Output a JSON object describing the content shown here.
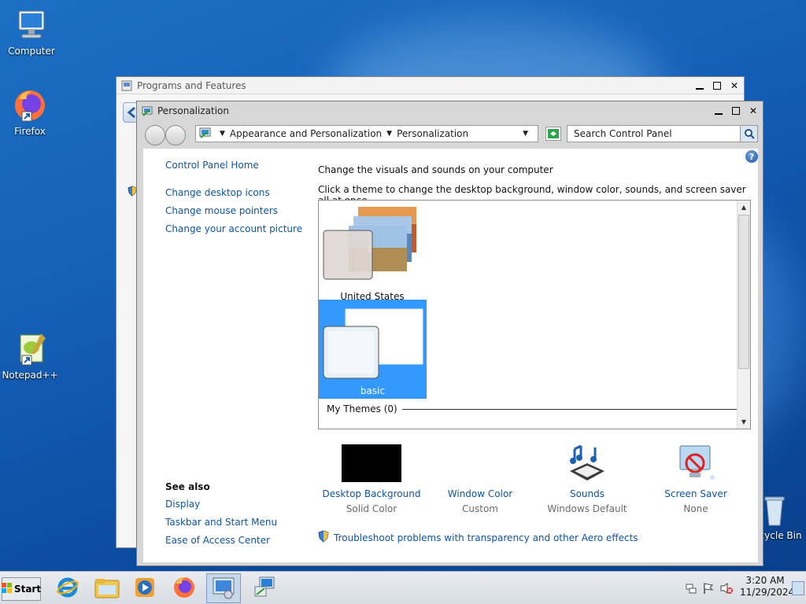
{
  "desktop": {
    "icons": [
      {
        "label": "Computer"
      },
      {
        "label": "Firefox"
      },
      {
        "label": "Notepad++"
      },
      {
        "label": "Recycle Bin"
      }
    ]
  },
  "programs_window": {
    "title": "Programs and Features"
  },
  "personalization": {
    "title": "Personalization",
    "breadcrumb": [
      "Appearance and Personalization",
      "Personalization"
    ],
    "search_placeholder": "Search Control Panel",
    "left_pane": {
      "home": "Control Panel Home",
      "links": [
        "Change desktop icons",
        "Change mouse pointers",
        "Change your account picture"
      ],
      "see_also_title": "See also",
      "see_also": [
        "Display",
        "Taskbar and Start Menu",
        "Ease of Access Center"
      ]
    },
    "heading": "Change the visuals and sounds on your computer",
    "subheading": "Click a theme to change the desktop background, window color, sounds, and screen saver all at once.",
    "themes": [
      {
        "name": "United States",
        "selected": false
      },
      {
        "name": "basic",
        "selected": true
      }
    ],
    "my_themes_label": "My Themes (0)",
    "bottom": [
      {
        "label": "Desktop Background",
        "sub": "Solid Color"
      },
      {
        "label": "Window Color",
        "sub": "Custom"
      },
      {
        "label": "Sounds",
        "sub": "Windows Default"
      },
      {
        "label": "Screen Saver",
        "sub": "None"
      }
    ],
    "troubleshoot": "Troubleshoot problems with transparency and other Aero effects"
  },
  "taskbar": {
    "start_label": "Start",
    "time": "3:20 AM",
    "date": "11/29/2024"
  },
  "colors": {
    "link": "#0d56a4",
    "selection": "#3399ff",
    "desktop": "#1560b8"
  }
}
